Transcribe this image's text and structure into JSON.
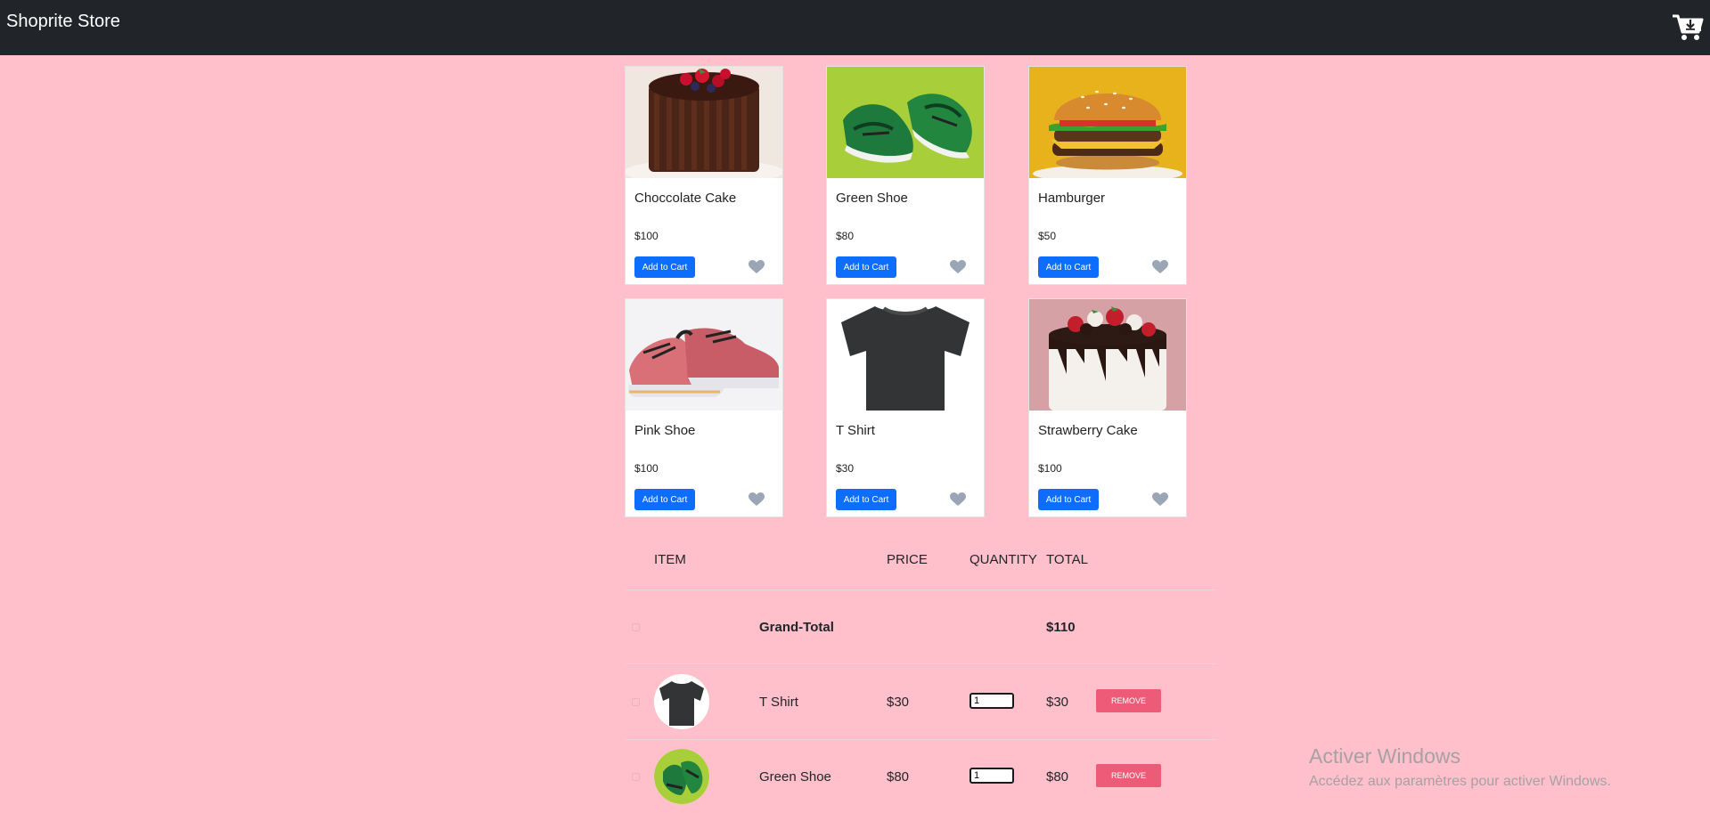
{
  "navbar": {
    "brand": "Shoprite Store",
    "cart_icon": "cart-download-icon"
  },
  "products": [
    {
      "name": "Choccolate Cake",
      "price": "$100",
      "button": "Add to Cart",
      "image": "chocolate-cake-image"
    },
    {
      "name": "Green Shoe",
      "price": "$80",
      "button": "Add to Cart",
      "image": "green-shoe-image"
    },
    {
      "name": "Hamburger",
      "price": "$50",
      "button": "Add to Cart",
      "image": "hamburger-image"
    },
    {
      "name": "Pink Shoe",
      "price": "$100",
      "button": "Add to Cart",
      "image": "pink-shoe-image"
    },
    {
      "name": "T Shirt",
      "price": "$30",
      "button": "Add to Cart",
      "image": "t-shirt-image"
    },
    {
      "name": "Strawberry Cake",
      "price": "$100",
      "button": "Add to Cart",
      "image": "strawberry-cake-image"
    }
  ],
  "cart": {
    "headers": {
      "item": "ITEM",
      "price": "PRICE",
      "quantity": "QUANTITY",
      "total": "TOTAL"
    },
    "grand_total_label": "Grand-Total",
    "grand_total_value": "$110",
    "rows": [
      {
        "name": "T Shirt",
        "price": "$30",
        "quantity": "1",
        "total": "$30",
        "remove": "REMOVE"
      },
      {
        "name": "Green Shoe",
        "price": "$80",
        "quantity": "1",
        "total": "$80",
        "remove": "REMOVE"
      }
    ]
  },
  "watermark": {
    "title": "Activer Windows",
    "subtitle": "Accédez aux paramètres pour activer Windows."
  },
  "colors": {
    "page_bg": "#ffc0cb",
    "navbar_bg": "#212529",
    "primary": "#0d6efd",
    "remove": "#ee5b78"
  }
}
